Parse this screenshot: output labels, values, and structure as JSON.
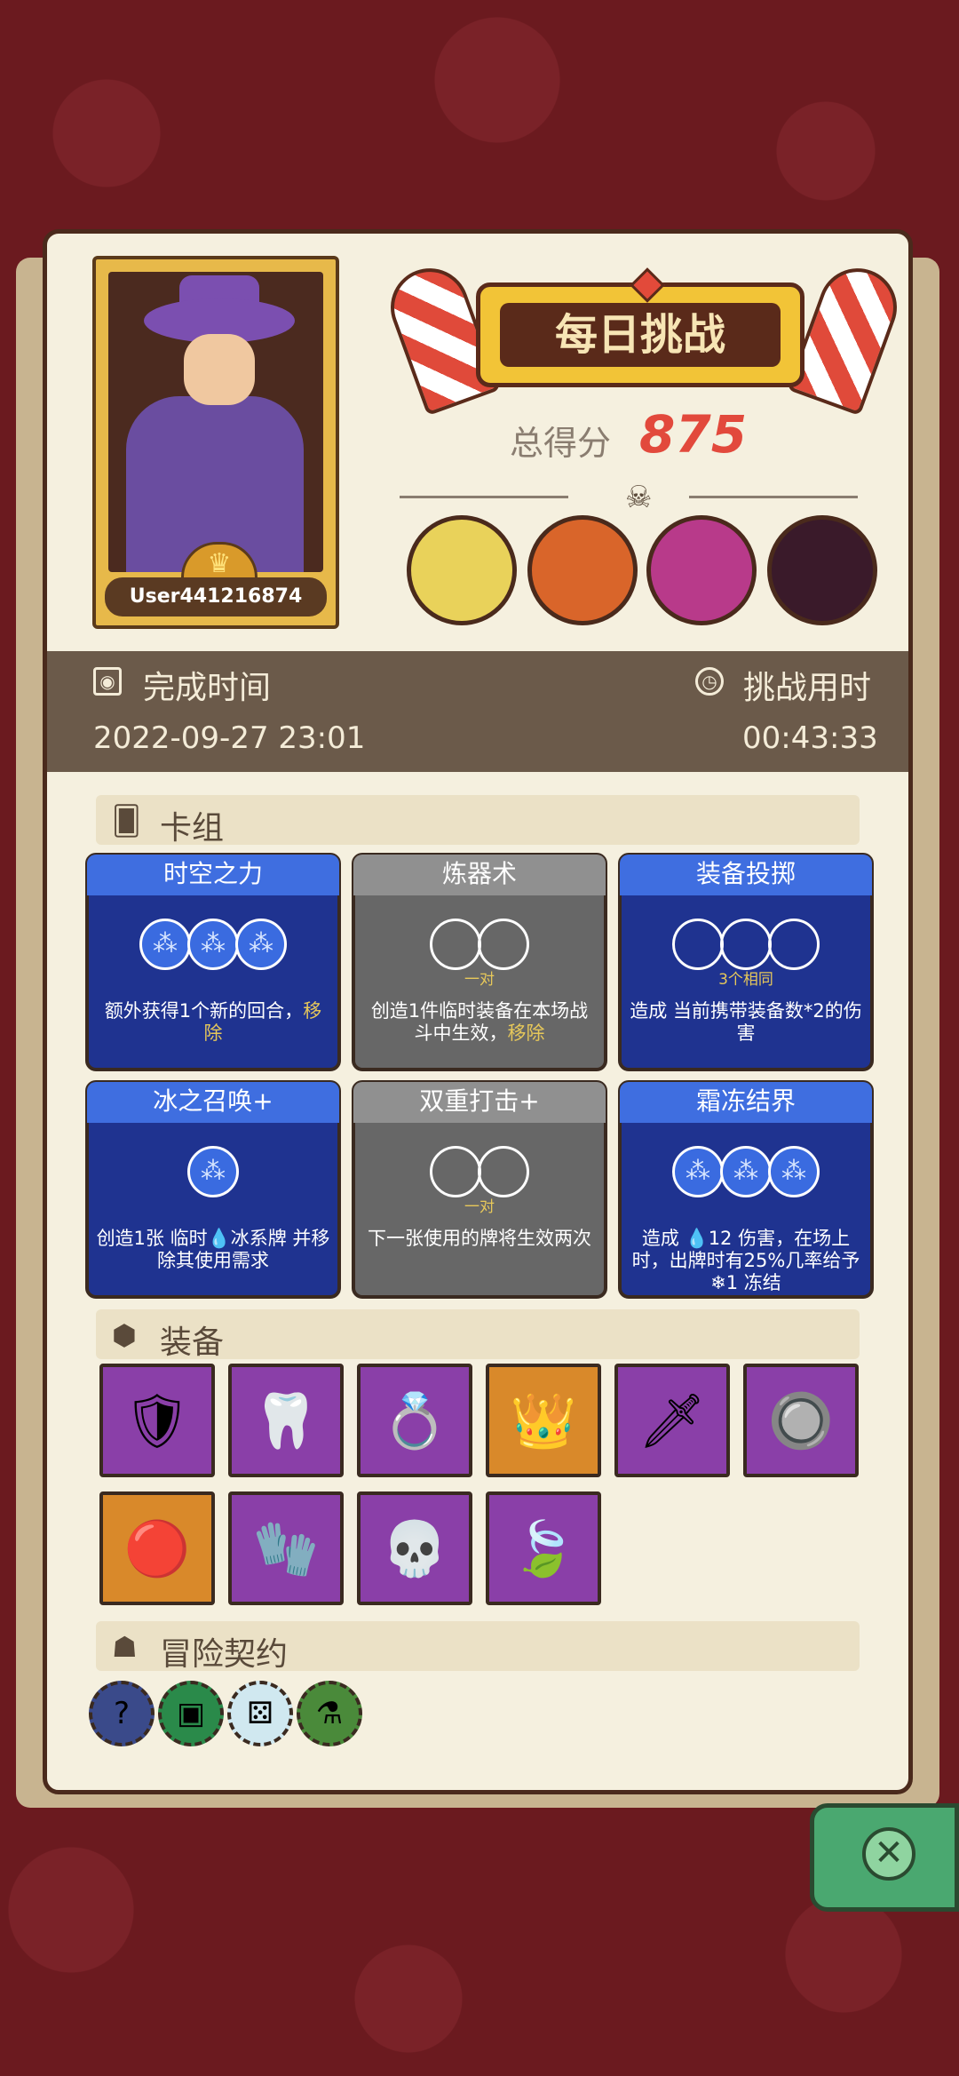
{
  "profile": {
    "username": "User441216874"
  },
  "title": "每日挑战",
  "score": {
    "label": "总得分",
    "value": "875"
  },
  "stats": {
    "finish_label": "完成时间",
    "finish_value": "2022-09-27 23:01",
    "duration_label": "挑战用时",
    "duration_value": "00:43:33"
  },
  "deck": {
    "title": "卡组",
    "cards": [
      {
        "name": "时空之力",
        "color": "blue",
        "gems": 3,
        "gem_type": "filled",
        "sub": "",
        "desc": "额外获得1个新的回合，",
        "desc_hl": "移除"
      },
      {
        "name": "炼器术",
        "color": "gray",
        "gems": 2,
        "gem_type": "empty",
        "sub": "一对",
        "desc": "创造1件临时装备在本场战斗中生效，",
        "desc_hl": "移除"
      },
      {
        "name": "装备投掷",
        "color": "blue",
        "gems": 3,
        "gem_type": "empty",
        "sub": "3个相同",
        "desc": "造成 当前携带装备数*2的伤害",
        "desc_hl": ""
      },
      {
        "name": "冰之召唤+",
        "color": "blue",
        "gems": 1,
        "gem_type": "filled",
        "sub": "",
        "desc": "创造1张 临时💧冰系牌 并移除其使用需求",
        "desc_hl": ""
      },
      {
        "name": "双重打击+",
        "color": "gray",
        "gems": 2,
        "gem_type": "empty",
        "sub": "一对",
        "desc": "下一张使用的牌将生效两次",
        "desc_hl": ""
      },
      {
        "name": "霜冻结界",
        "color": "blue",
        "gems": 3,
        "gem_type": "filled",
        "sub": "",
        "desc": "造成 💧12 伤害，在场上时，出牌时有25%几率给予 ❄1 冻结",
        "desc_hl": ""
      }
    ]
  },
  "equipment": {
    "title": "装备",
    "items": [
      {
        "icon": "dragon-shield-icon",
        "glyph": "🛡",
        "color": "purple"
      },
      {
        "icon": "fang-icon",
        "glyph": "🦷",
        "color": "purple"
      },
      {
        "icon": "diamond-ring-icon",
        "glyph": "💍",
        "color": "purple"
      },
      {
        "icon": "crown-icon",
        "glyph": "👑",
        "color": "orange"
      },
      {
        "icon": "dagger-icon",
        "glyph": "🗡",
        "color": "purple"
      },
      {
        "icon": "button-icon",
        "glyph": "🔘",
        "color": "purple"
      },
      {
        "icon": "amulet-icon",
        "glyph": "🔴",
        "color": "orange"
      },
      {
        "icon": "gauntlet-icon",
        "glyph": "🧤",
        "color": "purple"
      },
      {
        "icon": "skeleton-icon",
        "glyph": "💀",
        "color": "purple"
      },
      {
        "icon": "leaf-icon",
        "glyph": "🍃",
        "color": "purple"
      }
    ]
  },
  "contracts": {
    "title": "冒险契约",
    "items": [
      {
        "icon": "mystery-shield-icon",
        "glyph": "?"
      },
      {
        "icon": "treasure-chest-icon",
        "glyph": "▣"
      },
      {
        "icon": "dice-icon",
        "glyph": "⚄"
      },
      {
        "icon": "potion-icon",
        "glyph": "⚗"
      }
    ]
  },
  "colors": {
    "accent": "#e2493c",
    "panel": "#f5f0df",
    "bg": "#6b1a1f",
    "card_blue": "#1f3390",
    "card_gray": "#676767"
  }
}
